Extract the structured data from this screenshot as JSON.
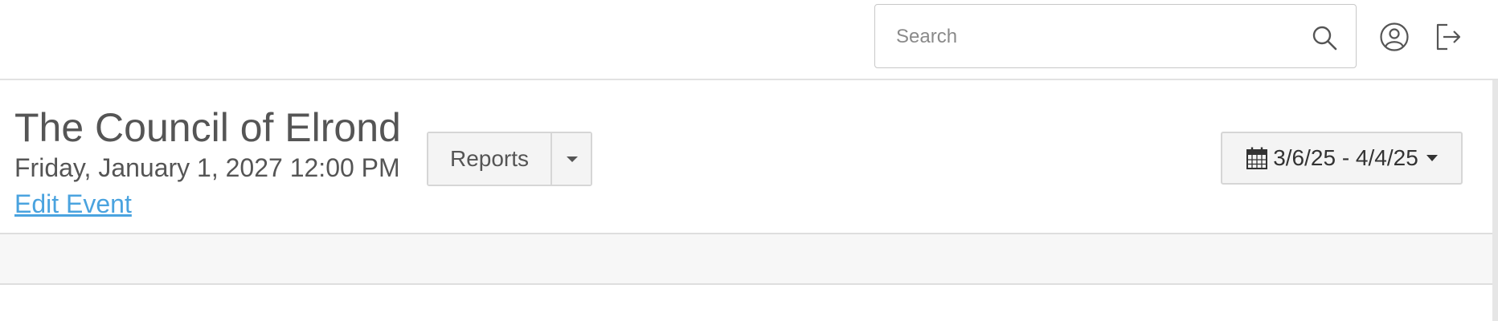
{
  "search": {
    "placeholder": "Search"
  },
  "icons": {
    "search": "search-icon",
    "user": "user-icon",
    "logout": "logout-icon",
    "calendar": "calendar-icon",
    "caret": "caret-down-icon"
  },
  "event": {
    "title": "The Council of Elrond",
    "date": "Friday, January 1, 2027 12:00 PM",
    "edit_label": "Edit Event"
  },
  "reports": {
    "label": "Reports"
  },
  "date_range": {
    "label": "3/6/25 - 4/4/25"
  },
  "colors": {
    "link": "#4aa3df",
    "text": "#555555",
    "button_bg": "#f4f4f4",
    "border": "#d6d6d6",
    "band_bg": "#f7f7f7"
  }
}
